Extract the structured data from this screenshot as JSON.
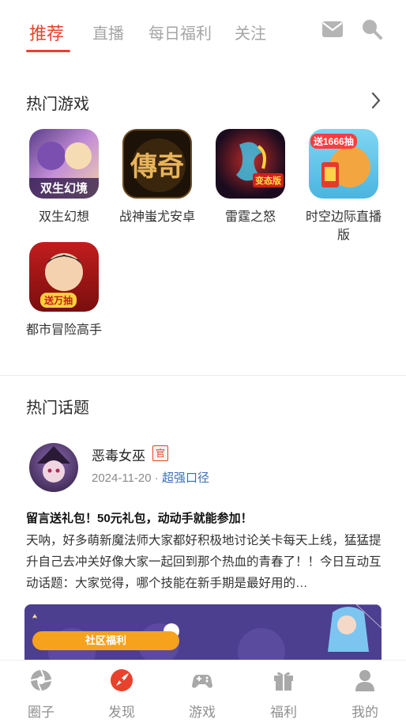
{
  "tabs": [
    {
      "label": "推荐",
      "active": true
    },
    {
      "label": "直播"
    },
    {
      "label": "每日福利"
    },
    {
      "label": "关注"
    }
  ],
  "hot_games": {
    "title": "热门游戏",
    "games": [
      {
        "name": "双生幻想",
        "icon_text": "双生幻境"
      },
      {
        "name": "战神蚩尤安卓",
        "icon_text": "傳奇"
      },
      {
        "name": "雷霆之怒",
        "icon_text": "变态版"
      },
      {
        "name": "时空边际直播版",
        "icon_text": "送1666抽"
      },
      {
        "name": "都市冒险高手",
        "icon_text": "送万抽"
      }
    ]
  },
  "hot_topics": {
    "title": "热门话题",
    "post": {
      "author": "恶毒女巫",
      "badge": "官",
      "date": "2024-11-20",
      "separator": "·",
      "game_link": "超强口径",
      "title": "留言送礼包！50元礼包，动动手就能参加！",
      "body": "天呐，好多萌新魔法师大家都好积极地讨论关卡每天上线，猛猛提升自己去冲关好像大家一起回到那个热血的青春了！！今日互动互动话题：大家觉得，哪个技能在新手期是最好用的…",
      "banner_tag": "社区福利"
    }
  },
  "bottom_nav": [
    {
      "label": "圈子",
      "icon": "aperture-icon"
    },
    {
      "label": "发现",
      "icon": "discover-icon",
      "active": true
    },
    {
      "label": "游戏",
      "icon": "gamepad-icon"
    },
    {
      "label": "福利",
      "icon": "gift-icon"
    },
    {
      "label": "我的",
      "icon": "user-icon"
    }
  ],
  "colors": {
    "accent": "#e8412c",
    "inactive": "#a6a6a6",
    "link": "#3a6fb5"
  }
}
